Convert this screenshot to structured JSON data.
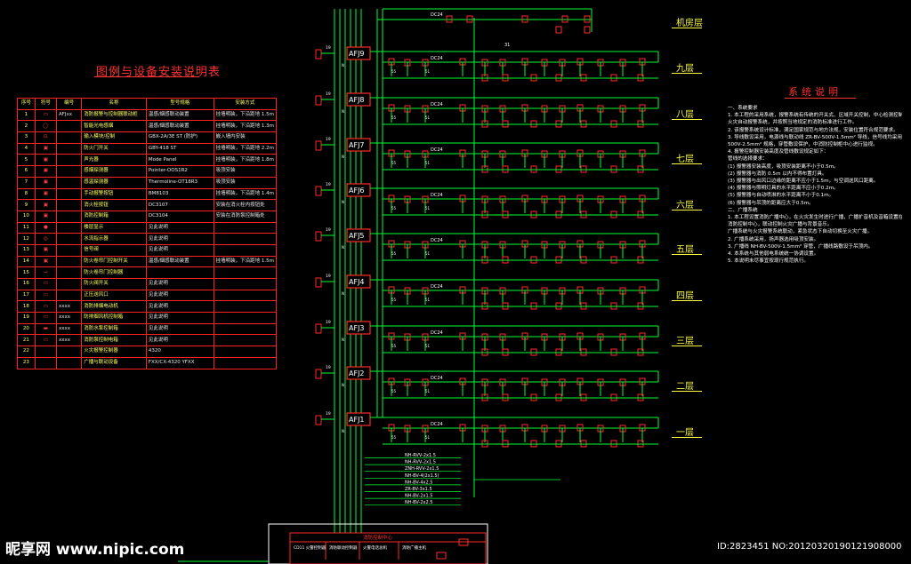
{
  "legend": {
    "title": "图例与设备安装说明表",
    "headers": [
      "序号",
      "符号",
      "编号",
      "名称",
      "型号规格",
      "安装方式"
    ],
    "rows": [
      {
        "no": "1",
        "sym": "▭",
        "code": "AFJxx",
        "name": "消防报警与控制器联动柜",
        "model": "温感/烟感联动装置",
        "inst": "挂墙明装，下沿距地 1.5m"
      },
      {
        "no": "2",
        "sym": "◯",
        "code": "",
        "name": "智能光电感烟",
        "model": "温感/烟感联动装置",
        "inst": "挂墙明装，下沿距地 1.3m"
      },
      {
        "no": "3",
        "sym": "⊡",
        "code": "",
        "name": "输入模块/控制",
        "model": "GBX-2A/3E ST (防护)",
        "inst": "嵌入墙内安装"
      },
      {
        "no": "4",
        "sym": "▣",
        "code": "",
        "name": "防火门开关",
        "model": "GBY-418 ST",
        "inst": "挂墙明装，下沿距地 2.2m"
      },
      {
        "no": "5",
        "sym": "▣",
        "code": "",
        "name": "声光器",
        "model": "Mode Panel",
        "inst": "挂墙明装，下沿距地 1.8m"
      },
      {
        "no": "6",
        "sym": "▣",
        "code": "",
        "name": "感烟探测器",
        "model": "Pointer-OOS1R2",
        "inst": "吸顶安装"
      },
      {
        "no": "7",
        "sym": "▣",
        "code": "",
        "name": "感温探测器",
        "model": "Thermoline-OT18R3",
        "inst": "吸顶安装"
      },
      {
        "no": "8",
        "sym": "▣",
        "code": "",
        "name": "手动报警按钮",
        "model": "BM8103",
        "inst": "挂墙明装，下沿距地 1.4m"
      },
      {
        "no": "9",
        "sym": "▣",
        "code": "",
        "name": "消火栓按钮",
        "model": "DC3107",
        "inst": "安装在消火栓内按钮处"
      },
      {
        "no": "10",
        "sym": "▣",
        "code": "",
        "name": "消防控制箱",
        "model": "DC3104",
        "inst": "安装在消防泵控制箱处"
      },
      {
        "no": "11",
        "sym": "●",
        "code": "",
        "name": "楼层显示",
        "model": "见此说明",
        "inst": ""
      },
      {
        "no": "12",
        "sym": "◎",
        "code": "",
        "name": "水流指示器",
        "model": "见此说明",
        "inst": ""
      },
      {
        "no": "13",
        "sym": "▣",
        "code": "",
        "name": "信号阀",
        "model": "见此说明",
        "inst": ""
      },
      {
        "no": "14",
        "sym": "▣",
        "code": "",
        "name": "防火卷帘门控制开关",
        "model": "温感/烟感联动装置",
        "inst": "挂墙明装，下沿距地 1.5m"
      },
      {
        "no": "15",
        "sym": "⊸",
        "code": "",
        "name": "防火卷帘门控制器",
        "model": "",
        "inst": ""
      },
      {
        "no": "16",
        "sym": "▭",
        "code": "",
        "name": "防火阀开关",
        "model": "见此说明",
        "inst": ""
      },
      {
        "no": "17",
        "sym": "▭",
        "code": "",
        "name": "正压送风口",
        "model": "见此说明",
        "inst": ""
      },
      {
        "no": "18",
        "sym": "▭",
        "code": "xxxx",
        "name": "消防排烟电动机",
        "model": "见此说明",
        "inst": ""
      },
      {
        "no": "19",
        "sym": "▭",
        "code": "xxxx",
        "name": "防排烟风机控制箱",
        "model": "见此说明",
        "inst": ""
      },
      {
        "no": "20",
        "sym": "▬",
        "code": "xxxx",
        "name": "消防水泵控制箱",
        "model": "见此说明",
        "inst": ""
      },
      {
        "no": "21",
        "sym": "▭",
        "code": "xxxx",
        "name": "消防泵控制电箱",
        "model": "见此说明",
        "inst": ""
      },
      {
        "no": "22",
        "sym": "",
        "code": "",
        "name": "火灾报警控制器",
        "model": "4320",
        "inst": ""
      },
      {
        "no": "23",
        "sym": "",
        "code": "",
        "name": "广播与联动设备",
        "model": "FXX/CX-4320 YFXX",
        "inst": ""
      }
    ]
  },
  "system": {
    "title": "系统说明",
    "notes": [
      "一、系统要求",
      "1. 本工程的采用系统，报警系统有传统的开关式、区域开关控制，中心检测控制器，",
      "   火灾自动报警系统，并按照当地规定的消防标准进行工作。",
      "2. 该报警系统设计标准，满足国家规范与地方法规，安装位置符合规范要求。",
      "3. 导线敷设采用，电源线与联动线    ZR-BV-500V-1.5mm² 导线，信号线均采用",
      "   500V-2.5mm² 规格，穿管敷设保护，中消防控制柜中心进行监视。",
      "4. 报警控制器安装高度及管线敷设规定如下：",
      "   管线的选择要求：",
      "   (1) 报警器安装高度，吸顶安装距离不小于0.5m。",
      "   (2) 报警器与消防 0.5m 以内不得布置灯具。",
      "   (3) 报警器与出风口边缘的距离不应小于1.5m，与空调送风口距离。",
      "   (4) 报警器与照明灯具的水平距离不应小于0.2m。",
      "   (5) 报警器与自动喷淋的水平距离不小于0.1m。",
      "   (6) 报警器与吊顶的距离应大于0.5m。",
      "二、广播系统",
      "1. 本工程设置消防广播中心，在火灾发生时进行广播，广播扩音机及音箱设置在",
      "   消防控制中心，联动控制火灾广播与背景音乐。",
      "   广播系统与火灾报警系统联动，紧急状态下自动切换至火灾广播。",
      "2. 广播系统采用，扬声器选用吸顶安装。",
      "3. 广播线    NH-BV-500V-1.5mm²    穿管，广播线路敷设于吊顶内。",
      "4. 本系统与其他弱电系统统一协调设置。",
      "5. 本说明未尽事宜按现行规范执行。"
    ]
  },
  "floors": [
    "机房层",
    "九层",
    "八层",
    "七层",
    "六层",
    "五层",
    "四层",
    "三层",
    "二层",
    "一层"
  ],
  "panels": [
    "AFJ9",
    "AFJ8",
    "AFJ7",
    "AFJ6",
    "AFJ5",
    "AFJ4",
    "AFJ3",
    "AFJ2",
    "AFJ1"
  ],
  "cable_notes": [
    "NH-RVV-2x1.5",
    "NH-RVV-2x1.5",
    "ZNH-RVV-2x1.5",
    "NH-BV-4(2x1.5)",
    "NH-BV-4x2.5",
    "ZR-BV-3x1.5",
    "NH-BV-2x1.5",
    "NH-BV-2x2.5"
  ],
  "control_room": {
    "title": "消防控制中心",
    "cells": [
      "CD11 火警控制器",
      "消防联动控制器",
      "火警电话总机",
      "消防广播主机"
    ]
  },
  "bus_labels": {
    "dc24": "DC24",
    "n31": "31"
  },
  "watermark": {
    "logo": "昵享网 www.nipic.com",
    "id": "ID:2823451 NO:20120320190121908000"
  }
}
